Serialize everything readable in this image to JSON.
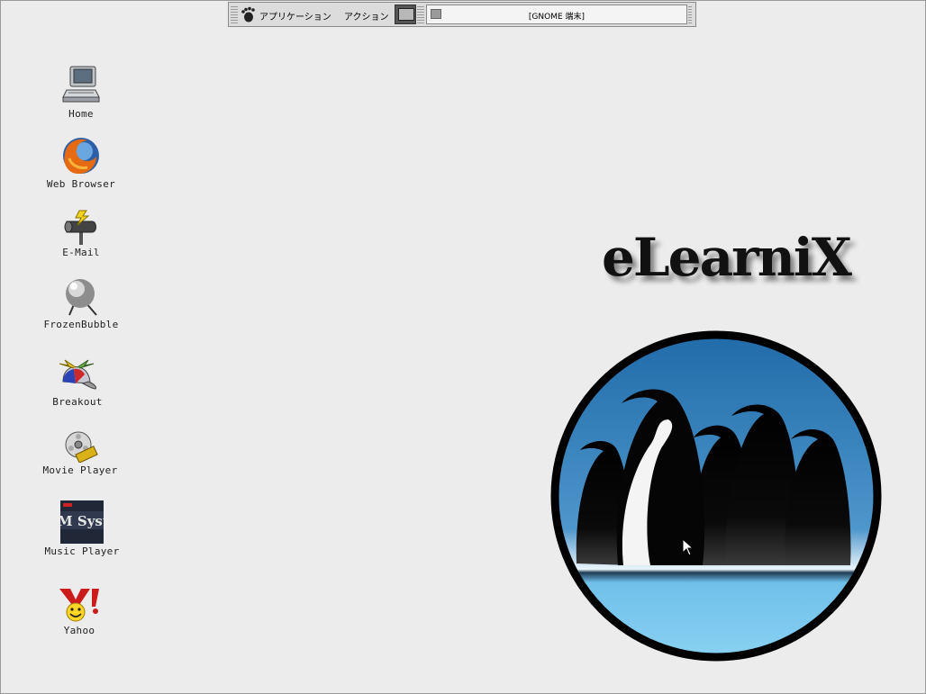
{
  "panel": {
    "applications_label": "アプリケーション",
    "actions_label": "アクション",
    "task_label": "[GNOME 端末]"
  },
  "desktop_icons": [
    {
      "label": "Home",
      "icon": "computer-icon"
    },
    {
      "label": "Web Browser",
      "icon": "firefox-icon"
    },
    {
      "label": "E-Mail",
      "icon": "mailbox-icon"
    },
    {
      "label": "FrozenBubble",
      "icon": "frozen-bubble-icon"
    },
    {
      "label": "Breakout",
      "icon": "breakout-cap-icon"
    },
    {
      "label": "Movie Player",
      "icon": "film-reel-icon"
    },
    {
      "label": "Music Player",
      "icon": "xmms-icon"
    },
    {
      "label": "Yahoo",
      "icon": "yahoo-icon"
    }
  ],
  "xmms_icon_text": "XMM System",
  "logo": {
    "text": "eLearniX"
  },
  "colors": {
    "desktop": "#ececec",
    "panel": "#dcdcdc",
    "logo_sky": "#2f7bb5",
    "logo_ice": "#7fc8ee"
  }
}
